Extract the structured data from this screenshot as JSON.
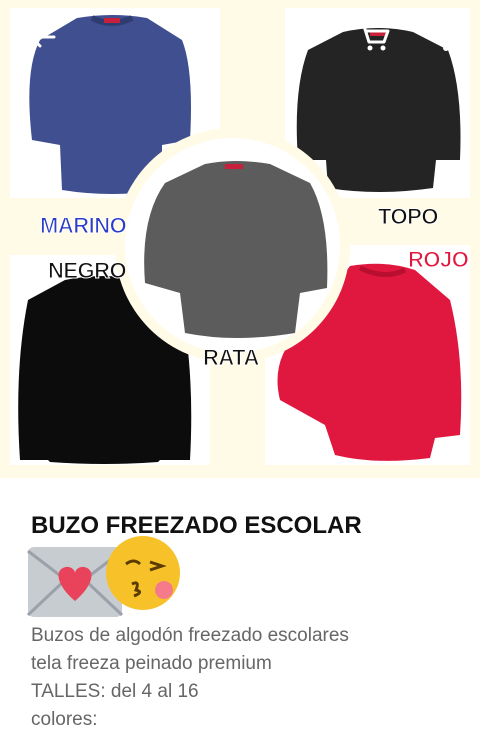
{
  "hero": {
    "labels": {
      "marino": "MARINO",
      "negro": "NEGRO",
      "topo": "TOPO",
      "rojo": "ROJO",
      "rata": "RATA"
    },
    "icons": [
      "back-arrow-icon",
      "cart-icon",
      "more-vert-icon"
    ]
  },
  "product": {
    "title": "BUZO FREEZADO ESCOLAR",
    "emoji_icons": [
      "love-letter-icon",
      "kissing-face-icon"
    ],
    "description": [
      "Buzos de algodón freezado escolares",
      "tela freeza peinado premium",
      "TALLES: del 4 al 16",
      "colores:"
    ]
  },
  "colors": {
    "marino": "#3f4f8f",
    "negro": "#0c0c0c",
    "topo": "#242424",
    "rojo": "#e0173f",
    "rata": "#5c5c5c"
  }
}
